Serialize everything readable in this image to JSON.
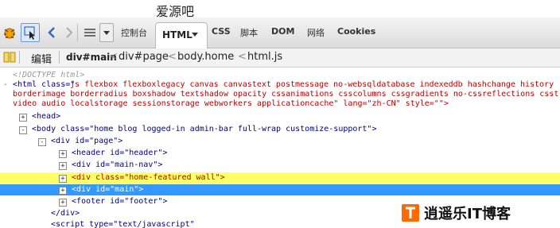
{
  "page": {
    "heading": "爱源吧"
  },
  "toolbar": {
    "tabs": [
      "控制台",
      "HTML",
      "CSS",
      "脚本",
      "DOM",
      "网络",
      "Cookies"
    ],
    "active_tab": "HTML"
  },
  "breadcrumb": {
    "edit_label": "编辑",
    "items": [
      "div#main",
      "div#page",
      "body.home",
      "html.js"
    ],
    "separator": "<"
  },
  "html_tree": {
    "doctype": "<!DOCTYPE html>",
    "html_open_prefix": "<html class=\"",
    "html_class_line1": " js flexbox flexboxlegacy canvas canvastext postmessage no-websqldatabase indexeddb hashchange history",
    "html_class_line2": "borderimage borderradius boxshadow textshadow opacity cssanimations csscolumns cssgradients no-cssreflections csst",
    "html_class_line3": "video audio localstorage sessionstorage webworkers applicationcache\" lang=\"zh-CN\" style=\"\">",
    "head": "<head>",
    "body": "<body class=\"home blog logged-in admin-bar full-wrap customize-support\">",
    "div_page": "<div id=\"page\">",
    "header": "<header id=\"header\">",
    "main_nav": "<div id=\"main-nav\">",
    "featured": "<div class=\"home-featured wall\">",
    "main": "<div id=\"main\">",
    "footer": "<footer id=\"footer\">",
    "div_close": "</div>",
    "script_partial": "<script type=\"text/javascript\""
  },
  "watermark": {
    "text": "逍遥乐IT博客"
  },
  "colors": {
    "highlight_yellow": "#ffff66",
    "highlight_blue": "#3399ff",
    "watermark_orange": "#ff6a00"
  }
}
